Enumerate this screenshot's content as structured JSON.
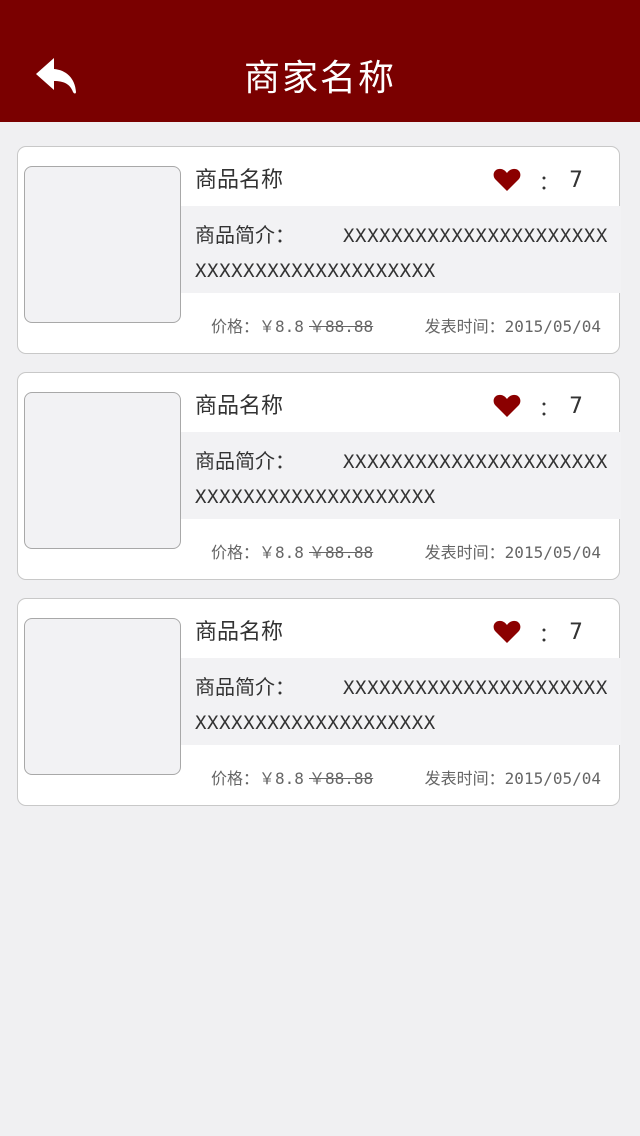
{
  "header": {
    "title": "商家名称",
    "back_icon": "back-arrow-icon"
  },
  "colors": {
    "header_bg": "#7a0000",
    "heart": "#8b0000",
    "page_bg": "#f0f0f2"
  },
  "products": [
    {
      "name": "商品名称",
      "like_colon": "：",
      "likes": "7",
      "intro_label": "商品简介：",
      "intro_text": "XXXXXXXXXXXXXXXXXXXXXXXXXXXXXXXXXXXXXXXXXX",
      "price_label": "价格：",
      "price": "￥8.8",
      "original_price": "￥88.88",
      "time_label": "发表时间：",
      "time": "2015/05/04"
    },
    {
      "name": "商品名称",
      "like_colon": "：",
      "likes": "7",
      "intro_label": "商品简介：",
      "intro_text": "XXXXXXXXXXXXXXXXXXXXXXXXXXXXXXXXXXXXXXXXXX",
      "price_label": "价格：",
      "price": "￥8.8",
      "original_price": "￥88.88",
      "time_label": "发表时间：",
      "time": "2015/05/04"
    },
    {
      "name": "商品名称",
      "like_colon": "：",
      "likes": "7",
      "intro_label": "商品简介：",
      "intro_text": "XXXXXXXXXXXXXXXXXXXXXXXXXXXXXXXXXXXXXXXXXX",
      "price_label": "价格：",
      "price": "￥8.8",
      "original_price": "￥88.88",
      "time_label": "发表时间：",
      "time": "2015/05/04"
    }
  ]
}
